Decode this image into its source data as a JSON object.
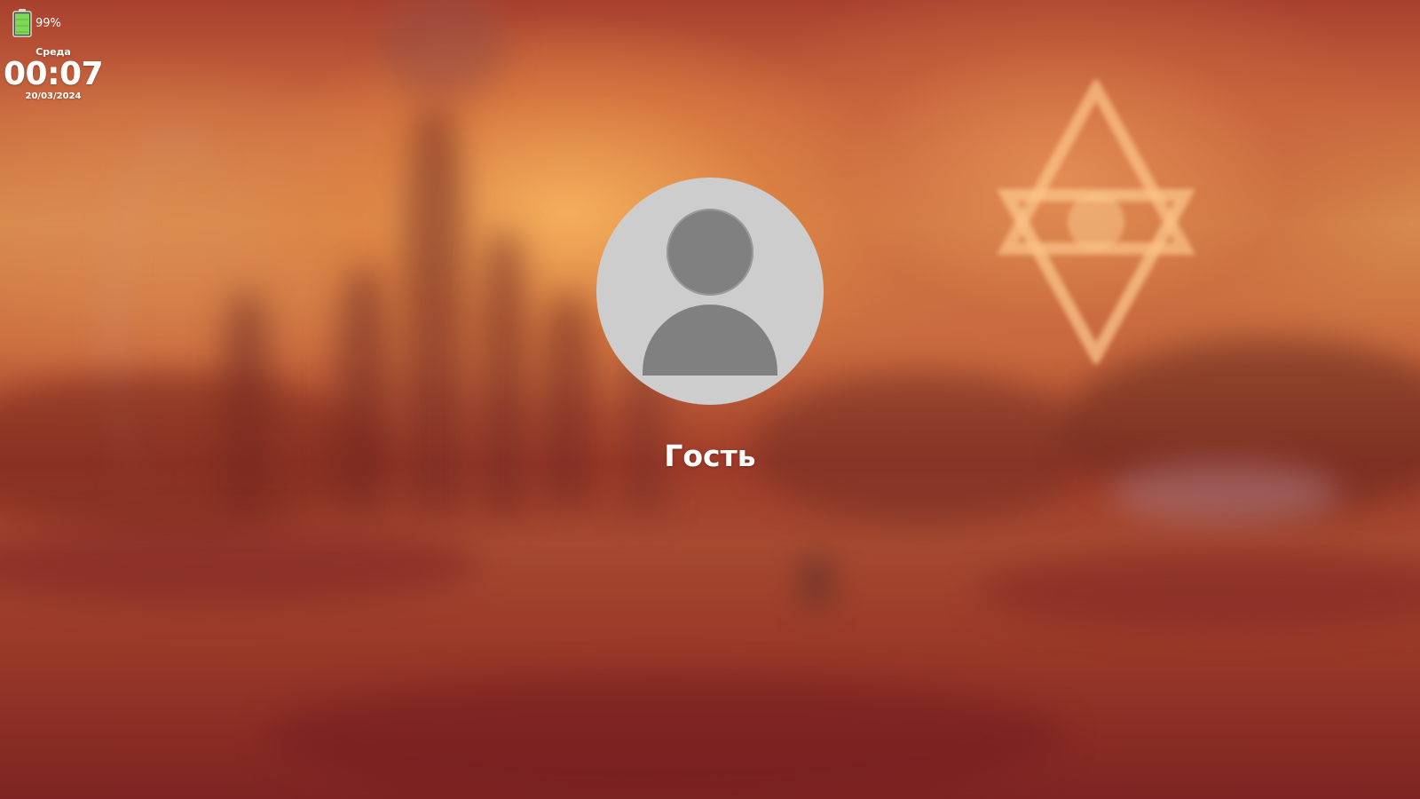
{
  "status": {
    "battery_percent": 99,
    "battery_label": "99%"
  },
  "clock": {
    "day": "Среда",
    "time": "00:07",
    "date": "20/03/2024"
  },
  "user": {
    "name": "Гость"
  },
  "icons": {
    "battery": "battery-icon",
    "avatar": "user-avatar-icon"
  },
  "colors": {
    "battery_fill": "#7ed957",
    "avatar_bg": "#cdcdcd",
    "avatar_fg": "#808080"
  }
}
